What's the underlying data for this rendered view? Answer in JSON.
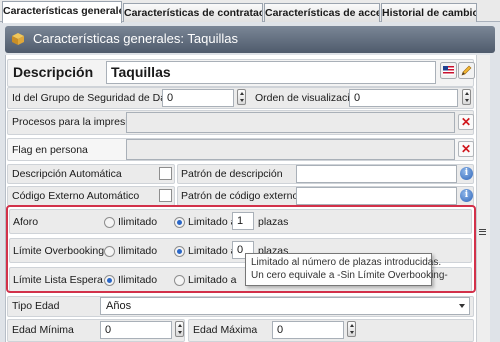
{
  "tabs": [
    {
      "label": "Características generales"
    },
    {
      "label": "Características de contratació..."
    },
    {
      "label": "Características de acceso"
    },
    {
      "label": "Historial de cambios"
    }
  ],
  "header": {
    "title": "Características generales: Taquillas"
  },
  "form": {
    "descripcion_label": "Descripción",
    "descripcion_value": "Taquillas",
    "grupo_seguridad_label": "Id del Grupo de Seguridad de Datos",
    "grupo_seguridad_value": "0",
    "orden_label": "Orden de visualización",
    "orden_value": "0",
    "procesos_label": "Procesos para la impresión",
    "flag_label": "Flag en persona",
    "desc_auto_label": "Descripción Automática",
    "patron_desc_label": "Patrón de descripción",
    "codigo_auto_label": "Código Externo Automático",
    "patron_codigo_label": "Patrón de código externo",
    "aforo": {
      "label": "Aforo",
      "opt_ilimitado": "Ilimitado",
      "opt_limitado": "Limitado a",
      "value": "1",
      "unit": "plazas",
      "selected": "Limitado a"
    },
    "overbooking": {
      "label": "Límite Overbooking",
      "opt_ilimitado": "Ilimitado",
      "opt_limitado": "Limitado a",
      "value": "0",
      "unit": "plazas",
      "selected": "Limitado a"
    },
    "espera": {
      "label": "Límite Lista Espera",
      "opt_ilimitado": "Ilimitado",
      "opt_limitado": "Limitado a",
      "selected": "Ilimitado"
    },
    "tipo_edad_label": "Tipo Edad",
    "tipo_edad_value": "Años",
    "edad_min_label": "Edad Mínima",
    "edad_min_value": "0",
    "edad_max_label": "Edad Máxima",
    "edad_max_value": "0"
  },
  "tooltip": {
    "line1": "Limitado al número de plazas introducidas.",
    "line2": "Un cero equivale a -Sin Límite Overbooking-"
  },
  "colors": {
    "highlight": "#d2314a",
    "header": "#5f6b7b",
    "delete": "#d0161c"
  }
}
